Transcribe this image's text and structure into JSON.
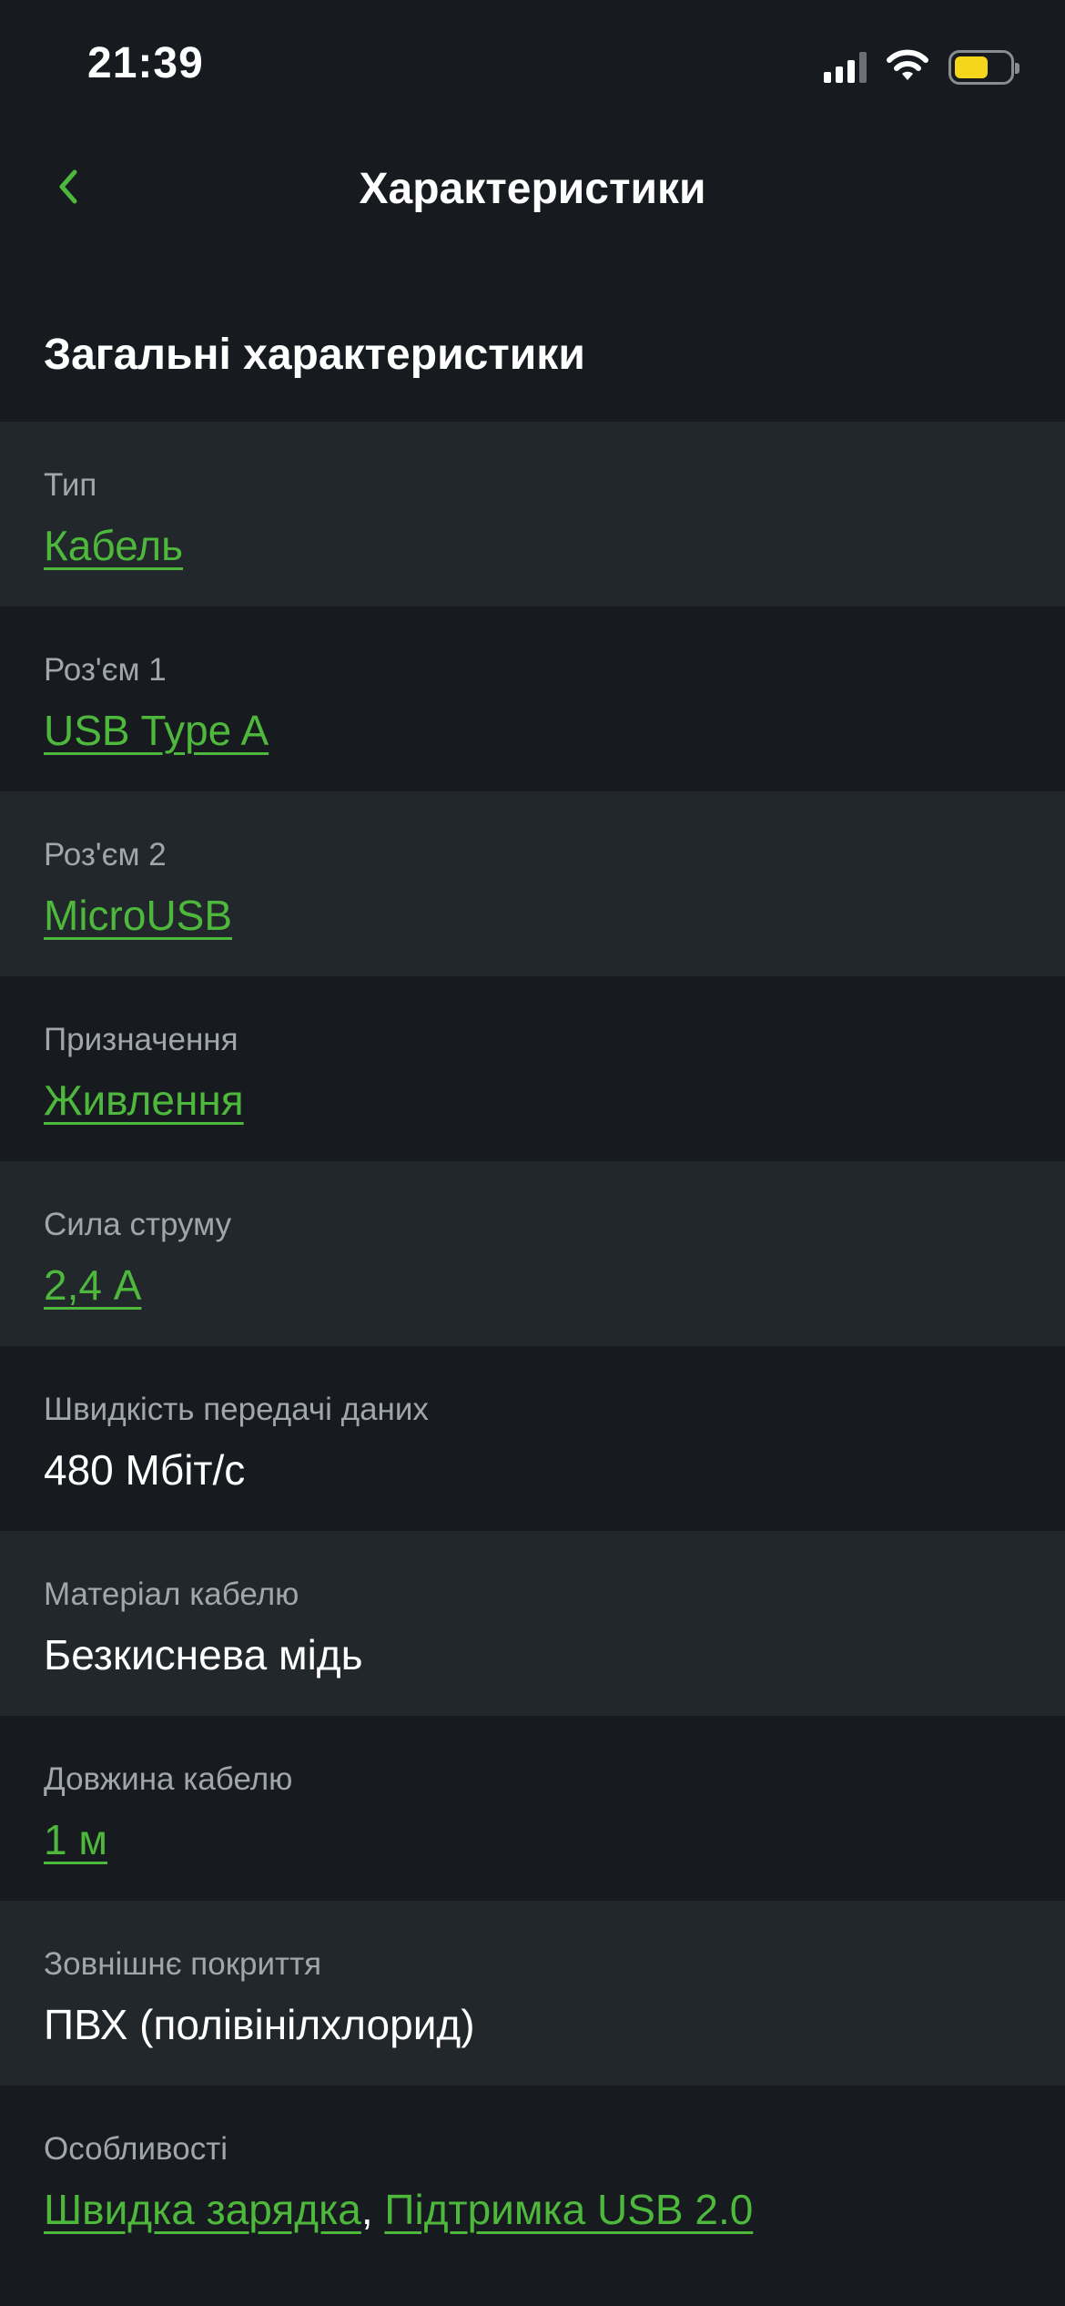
{
  "status_bar": {
    "time": "21:39",
    "battery_color": "#f5d61a"
  },
  "nav": {
    "back_icon": "chevron-left-icon",
    "title": "Характеристики",
    "accent_color": "#4eb83c"
  },
  "section": {
    "title": "Загальні характеристики"
  },
  "specs": [
    {
      "label": "Тип",
      "value": "Кабель",
      "is_link": true
    },
    {
      "label": "Роз'єм 1",
      "value": "USB Type A",
      "is_link": true
    },
    {
      "label": "Роз'єм 2",
      "value": "MicroUSB",
      "is_link": true
    },
    {
      "label": "Призначення",
      "value": "Живлення",
      "is_link": true
    },
    {
      "label": "Сила струму",
      "value": "2,4 А",
      "is_link": true
    },
    {
      "label": "Швидкість передачі даних",
      "value": "480 Мбіт/с",
      "is_link": false
    },
    {
      "label": "Матеріал кабелю",
      "value": "Безкиснева мідь",
      "is_link": false
    },
    {
      "label": "Довжина кабелю",
      "value": "1 м",
      "is_link": true
    },
    {
      "label": "Зовнішнє покриття",
      "value": "ПВХ (полівінілхлорид)",
      "is_link": false
    },
    {
      "label": "Особливості",
      "values": [
        "Швидка зарядка",
        "Підтримка USB 2.0"
      ],
      "separator": ",",
      "is_link": true
    }
  ]
}
